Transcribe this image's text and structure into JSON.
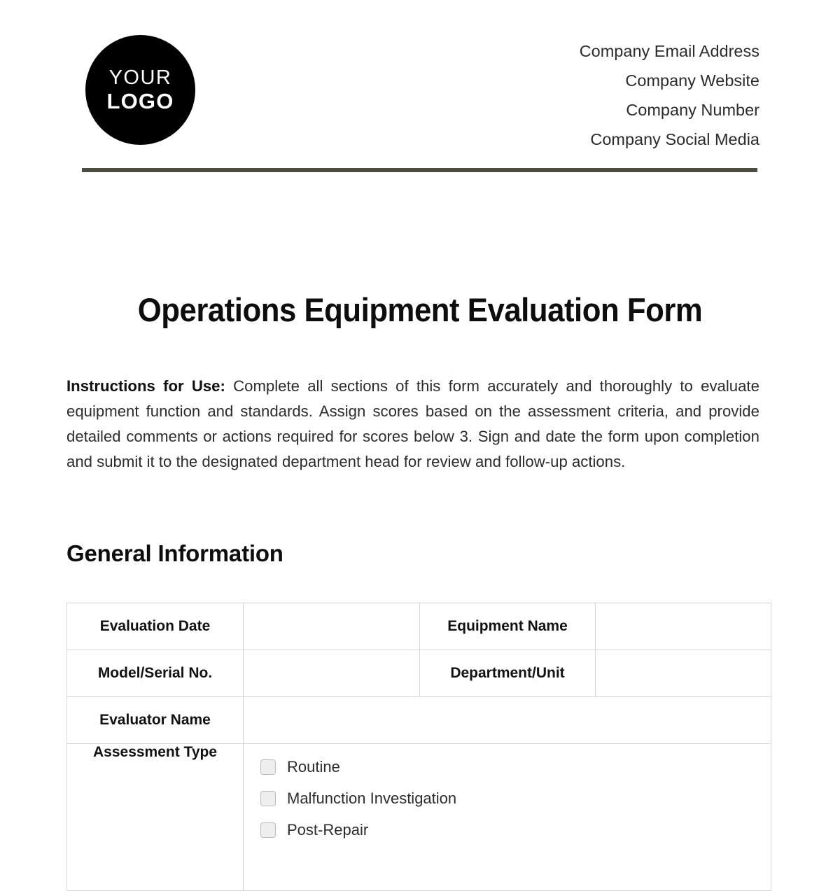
{
  "header": {
    "logo": {
      "line1": "YOUR",
      "line2": "LOGO"
    },
    "contact": [
      "Company Email Address",
      "Company Website",
      "Company Number",
      "Company Social Media"
    ],
    "rule_color": "#4d4c40"
  },
  "document": {
    "title": "Operations Equipment Evaluation Form",
    "instructions_label": "Instructions for Use:",
    "instructions_body": " Complete all sections of this form accurately and thoroughly to evaluate equipment function and standards. Assign scores based on the assessment criteria, and provide detailed comments or actions required for scores below 3. Sign and date the form upon completion and submit it to the designated department head for review and follow-up actions."
  },
  "general_information": {
    "heading": "General Information",
    "rows": [
      {
        "label_left": "Evaluation Date",
        "value_left": "",
        "label_right": "Equipment Name",
        "value_right": ""
      },
      {
        "label_left": "Model/Serial No.",
        "value_left": "",
        "label_right": "Department/Unit",
        "value_right": ""
      }
    ],
    "evaluator_name_label": "Evaluator Name",
    "evaluator_name_value": "",
    "assessment_type_label": "Assessment Type",
    "assessment_type_options": [
      "Routine",
      "Malfunction Investigation",
      "Post-Repair"
    ]
  }
}
